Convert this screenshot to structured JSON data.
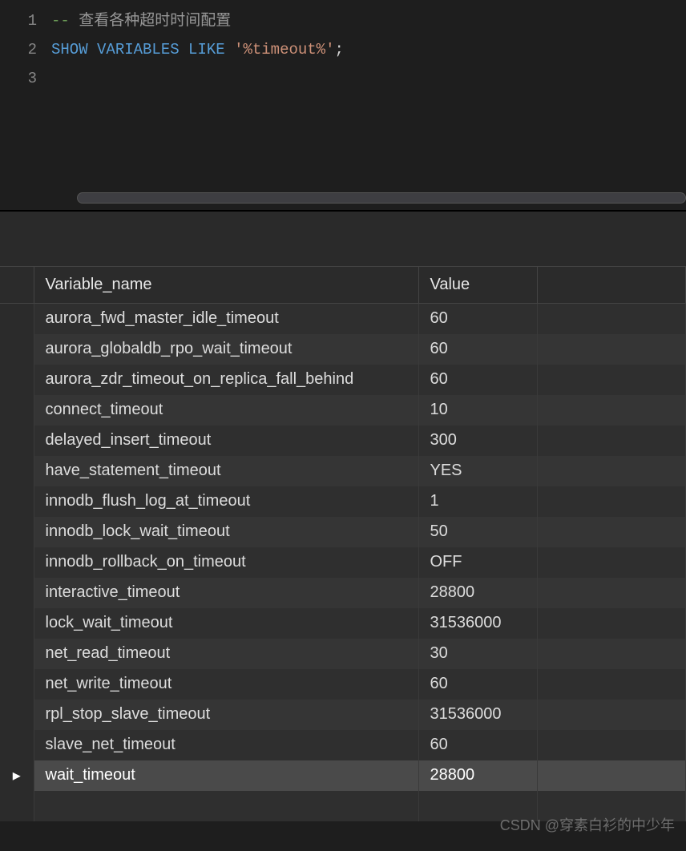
{
  "editor": {
    "lines": [
      {
        "n": "1",
        "tokens": []
      },
      {
        "n": "2",
        "tokens": [
          {
            "cls": "comment-dash",
            "t": "-- "
          },
          {
            "cls": "comment-text",
            "t": "查看各种超时时间配置"
          }
        ]
      },
      {
        "n": "3",
        "tokens": [
          {
            "cls": "keyword",
            "t": "SHOW"
          },
          {
            "cls": "",
            "t": " "
          },
          {
            "cls": "keyword",
            "t": "VARIABLES"
          },
          {
            "cls": "",
            "t": " "
          },
          {
            "cls": "keyword",
            "t": "LIKE"
          },
          {
            "cls": "",
            "t": " "
          },
          {
            "cls": "string",
            "t": "'%timeout%'"
          },
          {
            "cls": "punct",
            "t": ";"
          }
        ]
      }
    ]
  },
  "results": {
    "header_name": "Variable_name",
    "header_value": "Value",
    "rows": [
      {
        "name": "aurora_fwd_master_idle_timeout",
        "value": "60",
        "sel": false
      },
      {
        "name": "aurora_globaldb_rpo_wait_timeout",
        "value": "60",
        "sel": false
      },
      {
        "name": "aurora_zdr_timeout_on_replica_fall_behind",
        "value": "60",
        "sel": false
      },
      {
        "name": "connect_timeout",
        "value": "10",
        "sel": false
      },
      {
        "name": "delayed_insert_timeout",
        "value": "300",
        "sel": false
      },
      {
        "name": "have_statement_timeout",
        "value": "YES",
        "sel": false
      },
      {
        "name": "innodb_flush_log_at_timeout",
        "value": "1",
        "sel": false
      },
      {
        "name": "innodb_lock_wait_timeout",
        "value": "50",
        "sel": false
      },
      {
        "name": "innodb_rollback_on_timeout",
        "value": "OFF",
        "sel": false
      },
      {
        "name": "interactive_timeout",
        "value": "28800",
        "sel": false
      },
      {
        "name": "lock_wait_timeout",
        "value": "31536000",
        "sel": false
      },
      {
        "name": "net_read_timeout",
        "value": "30",
        "sel": false
      },
      {
        "name": "net_write_timeout",
        "value": "60",
        "sel": false
      },
      {
        "name": "rpl_stop_slave_timeout",
        "value": "31536000",
        "sel": false
      },
      {
        "name": "slave_net_timeout",
        "value": "60",
        "sel": false
      },
      {
        "name": "wait_timeout",
        "value": "28800",
        "sel": true
      }
    ],
    "selected_marker": "▸"
  },
  "watermark": "CSDN @穿素白衫的中少年"
}
